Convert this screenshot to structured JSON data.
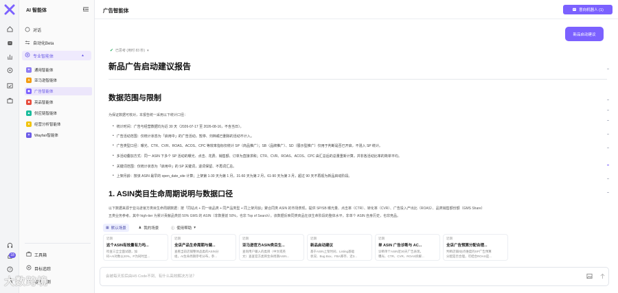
{
  "rail": {
    "badge": "18"
  },
  "sidebar": {
    "title": "AI 智能体",
    "items": [
      {
        "label": "对话",
        "icon": "chat-bubble-icon"
      },
      {
        "label": "自动化Beta",
        "icon": "automation-icon"
      }
    ],
    "group": {
      "label": "专业智能体"
    },
    "agents": [
      {
        "label": "通用智能体",
        "color": "#8e7cf3"
      },
      {
        "label": "亚马逊智能体",
        "color": "#f39c12"
      },
      {
        "label": "广告智能体",
        "color": "#7b61ff"
      },
      {
        "label": "亮品智能体",
        "color": "#e74c3c"
      },
      {
        "label": "供应链智能体",
        "color": "#1abc9c"
      },
      {
        "label": "经营分析智能体",
        "color": "#f1c40f"
      },
      {
        "label": "Wayfair智能体",
        "color": "#6c5ce7"
      }
    ],
    "bottom": [
      {
        "label": "工具箱"
      },
      {
        "label": "目标追踪"
      },
      {
        "label": "智能预测"
      }
    ]
  },
  "header": {
    "title": "广告智能体",
    "button": "意向机器人 (1)"
  },
  "chat": {
    "user_message": "新品启动建议",
    "thought": "已思考 (用时 83 秒)",
    "h1": "新品广告启动建议报告",
    "h2_scope": "数据范围与限制",
    "scope_intro": "为保证数据可核对，本报告统一采用以下统计口径：",
    "bullets": [
      "统计时间：广告与经营数据均为近 30 天（2026-07-17 至 2026-08-16，不含当日）。",
      "广告活动范围：仅统计状态为「启用中」的广告活动，暂停、归档或已删除的活动不计入。",
      "广告类型口径：曝光、CTR、CVR、ROAS、ACOS、CPC 等效率指标仅统计 SP（商品推广）；SB（品牌推广）、SD（展示型推广）仅用于判断是否已开启，不混入 SP 统计。",
      "多活动叠加方式：同一 ASIN 下多个 SP 活动的曝光、点击、花费、销售额、订单为直接求和；CTR、CVR、ROAS、ACOS、CPC 由汇总后的总量重新计算，并非各活动比率的简单平均。",
      "关键词范围：仅统计状态为「启用中」的 SP 关键词，退词保留、不再词汇总。",
      "上架月龄：按该 ASIN 最早的 open_date_site 计算；上架第 1-30 天为第 1 月，31-60 天为第 2 月，61-90 天为第 3 月，超过 90 天不再视为新品启动阶段。"
    ],
    "h2_lifecycle": "1. ASIN类目生命周期说明与数据口径",
    "lifecycle_p1": "以下数据来源于亚马逊官方类目生命周期数据：按「同站点 + 同一级品类 + 同产品类型 + 同上架月龄」聚合同类 ASIN 的市场表现，提供 SP/SB 曝光量、点击率（CTR）、转化率（CVR）、广告投入产出比（ROAS）、品类销售额份额（GMS Share）",
    "lifecycle_p2": "五类业务参考。其中 high-tier 为累计贡献品类前 50% GMS 的 ASIN（非数量前 50%，也非 Top of Search）。该数据反映同类商品在该生命阶段的整体水平，非单个 ASIN 自身历史，也非竞品。"
  },
  "scenes": {
    "tabs": [
      {
        "label": "默认场景",
        "icon": "grid-icon"
      },
      {
        "label": "我的场景",
        "icon": "user-icon"
      },
      {
        "label": "使用帮助",
        "icon": "help-icon"
      }
    ],
    "cards": [
      {
        "tag": "近期",
        "title": "这个ASIN有效量有力吗...",
        "desc": "检查三全全面试题，加\n码+AI对数以20%，P为同时显..."
      },
      {
        "tag": "近期",
        "title": "全店产品生命周期与健...",
        "desc": "查看当前店铺整体品类的ASIN分\n组，AI生命周期参考分布，参..."
      },
      {
        "tag": "近期",
        "title": "亚马逊官方ASIN类目生...",
        "desc": "查询用户输入的类目（中文或英\n文）查查官方类目生命周期ASIN..."
      },
      {
        "tag": "近期",
        "title": "新品启动建议",
        "desc": "基于ASIN上架时间、Listing基础\n状况、Bug Box、FBA库存、近3..."
      },
      {
        "tag": "近期",
        "title": "单 ASIN 广告诊断与 AC...",
        "desc": "诊断单个ASIN近30天广告表现，\n曝光、CTR、CVR、ROAS拆解..."
      },
      {
        "tag": "近期",
        "title": "全店广告预算分配合理...",
        "desc": "判断店铺/站点维度的SP广告预算\n分配是否合理，可结合ROAS是..."
      }
    ]
  },
  "input": {
    "placeholder": "会被每天扣后由H5 Code不到、有什么高效解决方法？"
  },
  "watermark": "大数跨境"
}
